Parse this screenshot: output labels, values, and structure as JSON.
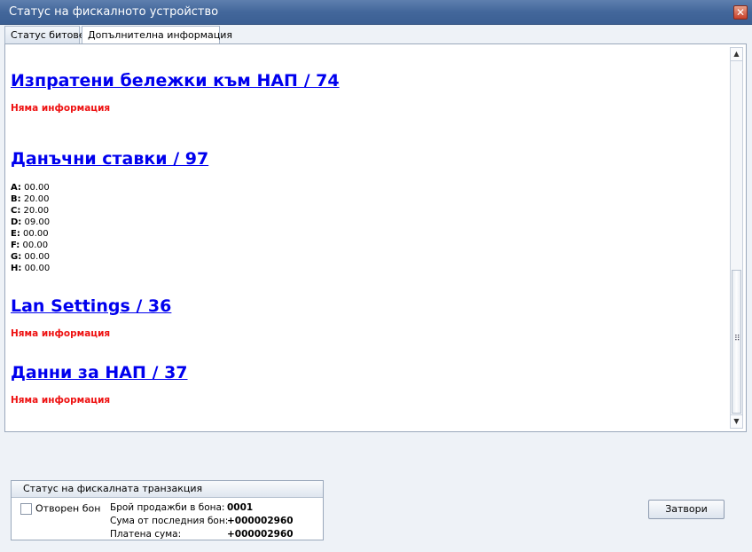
{
  "window": {
    "title": "Статус на фискалното устройство",
    "close_glyph": "✕"
  },
  "tabs": [
    {
      "label": "Статус битове",
      "active": false
    },
    {
      "label": "Допълнителна информация",
      "active": true
    }
  ],
  "sections": {
    "receipts": {
      "title": "Изпратени бележки към НАП / 74",
      "note": "Няма информация"
    },
    "tax": {
      "title": "Данъчни ставки / 97",
      "rates": [
        {
          "key": "A:",
          "value": "00.00"
        },
        {
          "key": "B:",
          "value": "20.00"
        },
        {
          "key": "C:",
          "value": "20.00"
        },
        {
          "key": "D:",
          "value": "09.00"
        },
        {
          "key": "E:",
          "value": "00.00"
        },
        {
          "key": "F:",
          "value": "00.00"
        },
        {
          "key": "G:",
          "value": "00.00"
        },
        {
          "key": "H:",
          "value": "00.00"
        }
      ]
    },
    "lan": {
      "title": "Lan Settings / 36",
      "note": "Няма информация"
    },
    "nap": {
      "title": "Данни за НАП / 37",
      "note": "Няма информация"
    }
  },
  "scrollbar": {
    "up_glyph": "▲",
    "down_glyph": "▼",
    "grip_glyph": "⠿"
  },
  "transaction": {
    "header": "Статус на фискалната транзакция",
    "checkbox_label": "Отворен бон",
    "rows": [
      {
        "key": "Брой продажби в бона:",
        "value": "0001"
      },
      {
        "key": "Сума от последния бон:",
        "value": "+000002960"
      },
      {
        "key": "Платена сума:",
        "value": "+000002960"
      }
    ]
  },
  "buttons": {
    "close_label": "Затвори"
  },
  "colors": {
    "link": "#0000ee",
    "no_info": "#ee1111",
    "titlebar": "#43679b"
  }
}
